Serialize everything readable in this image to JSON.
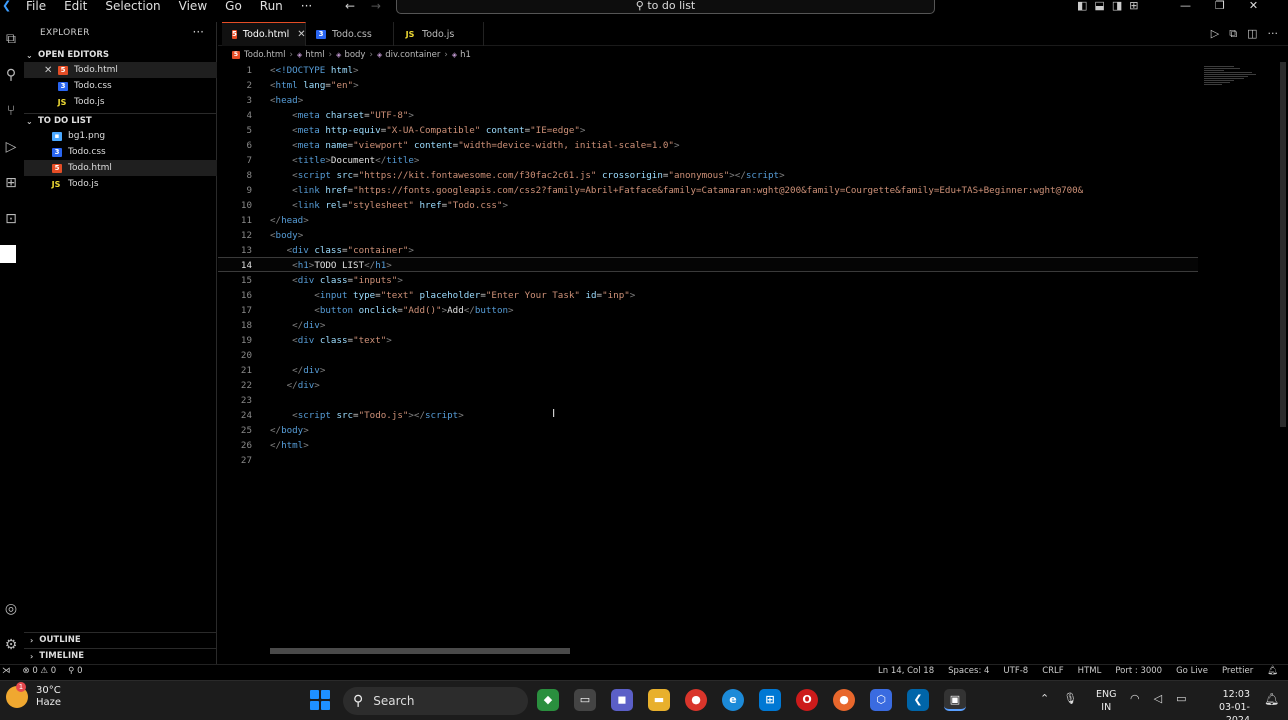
{
  "menu": [
    "File",
    "Edit",
    "Selection",
    "View",
    "Go",
    "Run",
    "···"
  ],
  "command_center": "to do list",
  "explorer": {
    "title": "EXPLORER",
    "open_editors_label": "OPEN EDITORS",
    "open_editors": [
      "Todo.html",
      "Todo.css",
      "Todo.js"
    ],
    "folder_label": "TO DO LIST",
    "files": [
      "bg1.png",
      "Todo.css",
      "Todo.html",
      "Todo.js"
    ],
    "outline_label": "OUTLINE",
    "timeline_label": "TIMELINE"
  },
  "tabs": [
    "Todo.html",
    "Todo.css",
    "Todo.js"
  ],
  "breadcrumb": [
    "Todo.html",
    "html",
    "body",
    "div.container",
    "h1"
  ],
  "code_lines": [
    "1",
    "2",
    "3",
    "4",
    "5",
    "6",
    "7",
    "8",
    "9",
    "10",
    "11",
    "12",
    "13",
    "14",
    "15",
    "16",
    "17",
    "18",
    "19",
    "20",
    "21",
    "22",
    "23",
    "24",
    "25",
    "26",
    "27"
  ],
  "code": {
    "l1_doctype": "<!DOCTYPE",
    "l1_html": "html",
    "l2_lang": "\"en\"",
    "l4_charset": "\"UTF-8\"",
    "l5_equiv": "\"X-UA-Compatible\"",
    "l5_content": "\"IE=edge\"",
    "l6_name": "\"viewport\"",
    "l6_content": "\"width=device-width, initial-scale=1.0\"",
    "l7_title": "Document",
    "l8_src": "\"https://kit.fontawesome.com/f30fac2c61.js\"",
    "l8_crossorigin": "\"anonymous\"",
    "l9_href": "\"https://fonts.googleapis.com/css2?family=Abril+Fatface&family=Catamaran:wght@200&family=Courgette&family=Edu+TAS+Beginner:wght@700&",
    "l10_rel": "\"stylesheet\"",
    "l10_href": "\"Todo.css\"",
    "l13_class": "\"container\"",
    "l14_text": "TODO LIST",
    "l15_class": "\"inputs\"",
    "l16_type": "\"text\"",
    "l16_placeholder": "\"Enter Your Task\"",
    "l16_id": "\"inp\"",
    "l17_onclick": "\"Add()\"",
    "l17_text": "Add",
    "l19_class": "\"text\"",
    "l24_src": "\"Todo.js\""
  },
  "statusbar": {
    "errors": "⊗ 0 ⚠ 0",
    "ports": "⚲ 0",
    "position": "Ln 14, Col 18",
    "spaces": "Spaces: 4",
    "encoding": "UTF-8",
    "eol": "CRLF",
    "language": "HTML",
    "port": "Port : 3000",
    "golive": "Go Live",
    "prettier": "Prettier"
  },
  "taskbar": {
    "temperature": "30°C",
    "weather": "Haze",
    "weather_badge": "1",
    "search_label": "Search",
    "lang_line1": "ENG",
    "lang_line2": "IN",
    "time": "12:03",
    "date": "03-01-2024"
  }
}
